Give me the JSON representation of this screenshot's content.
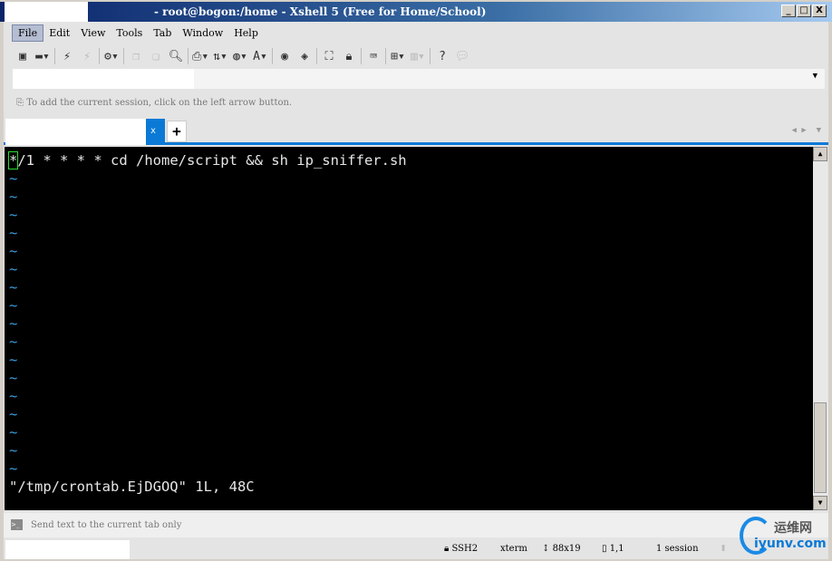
{
  "window": {
    "title": "- root@bogon:/home - Xshell 5 (Free for Home/School)",
    "minimize": "_",
    "maximize": "□",
    "close": "X"
  },
  "menu": [
    "File",
    "Edit",
    "View",
    "Tools",
    "Tab",
    "Window",
    "Help"
  ],
  "toolbar_icons": [
    "new-session-icon",
    "open-icon",
    "connect-icon",
    "disconnect-icon",
    "properties-icon",
    "copy-icon",
    "paste-icon",
    "find-icon",
    "print-icon",
    "transfer-icon",
    "globe-icon",
    "font-icon",
    "xftp-icon",
    "xmanager-icon",
    "fullscreen-icon",
    "lock-icon",
    "keyboard-icon",
    "new-tab-icon",
    "layout-icon",
    "help-icon",
    "chat-icon"
  ],
  "hint": "To add the current session, click on the left arrow button.",
  "tabs": {
    "close": "x",
    "add": "+"
  },
  "terminal": {
    "first_line_cursor": "*",
    "first_line_rest": "/1 * * * * cd /home/script && sh ip_sniffer.sh",
    "tilde": "~",
    "tilde_count": 17,
    "status_line": "\"/tmp/crontab.EjDGOQ\" 1L, 48C"
  },
  "sendbar": {
    "text": "Send text to the current tab only"
  },
  "statusbar": {
    "protocol": "SSH2",
    "term": "xterm",
    "size": "88x19",
    "position": "1,1",
    "sessions": "1 session"
  },
  "watermark": {
    "cn": "运维网",
    "en": "iyunv.com"
  }
}
